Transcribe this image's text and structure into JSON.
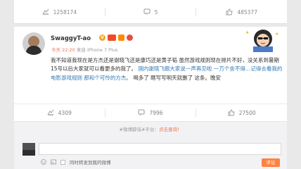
{
  "top_actions": {
    "share_count": "1258174",
    "comment_count": "5",
    "like_count": "485377"
  },
  "post": {
    "username": "SwaggyT-ao",
    "time": "今天 22:20",
    "source": "来自 iPhone 7 Plus",
    "content_parts": [
      {
        "text": "我不知道我现在是方杰还是谢晓飞还是康巧还是黄子韬  虽然游戏规则现在排片不好，没关系到暑期15号以后大家就可以看更多的我了。",
        "color": "default"
      },
      {
        "text": "国内谢晓飞跟大家说一声再见啦 一万个舍不得…记得去看我的电影游戏规则 那和个可怜的方杰。",
        "color": "blue"
      },
      {
        "text": "喝多了 瞎写写明天就删了 这条。晚安",
        "color": "default"
      }
    ],
    "share_count": "4309",
    "comment_count": "7996",
    "like_count": "27500"
  },
  "comment_box": {
    "topic_prefix": "#微博辟谣#平台：",
    "topic_link": "点击查询！",
    "checkbox_label": "同时转发到我的微博",
    "submit_label": "评论"
  }
}
